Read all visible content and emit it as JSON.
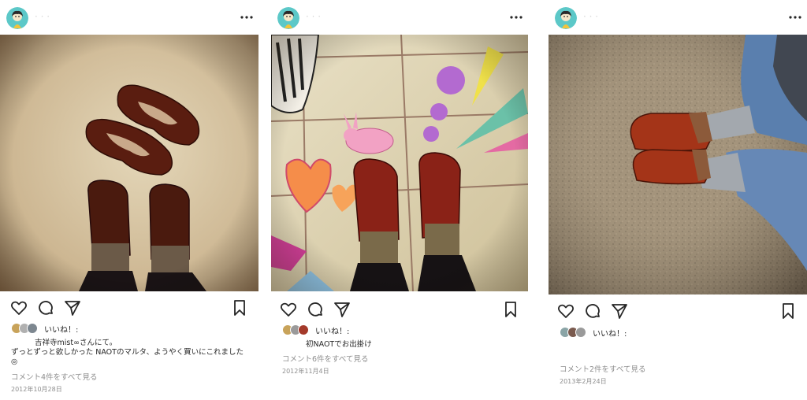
{
  "colors": {
    "text": "#262626",
    "muted": "#8e8e8e",
    "avatar_bg": "#5cc8c8"
  },
  "icons": {
    "like": "heart-icon",
    "comment": "comment-bubble-icon",
    "share": "send-paper-plane-icon",
    "save": "bookmark-icon",
    "more": "more-dots-icon"
  },
  "posts": [
    {
      "likes_label": "いいね！:",
      "caption_lines": [
        "吉祥寺mist∞さんにて。",
        "ずっとずっと欲しかった NAOTのマルタ、ようやく買いにこれました",
        "◎"
      ],
      "comments_link": "コメント4件をすべて見る",
      "date": "2012年10月28日"
    },
    {
      "likes_label": "いいね！:",
      "caption_lines": [
        "初NAOTでお出掛け"
      ],
      "comments_link": "コメント6件をすべて見る",
      "date": "2012年11月4日"
    },
    {
      "likes_label": "いいね！:",
      "caption_lines": [],
      "comments_link": "コメント2件をすべて見る",
      "date": "2013年2月24日"
    }
  ]
}
